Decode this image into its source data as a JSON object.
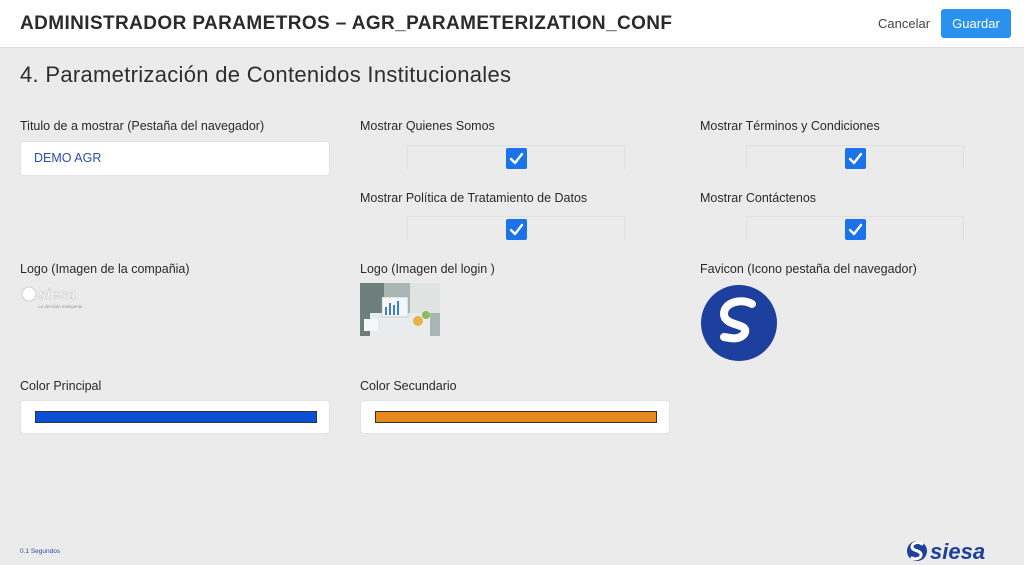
{
  "header": {
    "title": "ADMINISTRADOR PARAMETROS – AGR_PARAMETERIZATION_CONF",
    "cancel_label": "Cancelar",
    "save_label": "Guardar"
  },
  "section": {
    "title": "4. Parametrización de Contenidos Institucionales"
  },
  "fields": {
    "browser_title_label": "Titulo de a mostrar (Pestaña del navegador)",
    "browser_title_value": "DEMO AGR",
    "show_about_label": "Mostrar Quienes Somos",
    "show_about_checked": true,
    "show_terms_label": "Mostrar Términos y Condiciones",
    "show_terms_checked": true,
    "show_privacy_label": "Mostrar Política de Tratamiento de Datos",
    "show_privacy_checked": true,
    "show_contact_label": "Mostrar Contáctenos",
    "show_contact_checked": true,
    "company_logo_label": "Logo (Imagen de la compañia)",
    "login_logo_label": "Logo (Imagen del login )",
    "favicon_label": "Favicon (Icono pestaña del navegador)",
    "primary_color_label": "Color Principal",
    "primary_color": "#0a4fd4",
    "secondary_color_label": "Color Secundario",
    "secondary_color": "#e8891f"
  },
  "logos": {
    "company_logo_text": "siesa",
    "company_logo_tagline": "La decisión inteligente",
    "footer_logo_text": "siesa",
    "brand_color": "#1d3f9e"
  },
  "footer": {
    "time_text": "0.1 Segundos"
  },
  "colors": {
    "accent": "#2a91ef",
    "checkbox": "#1a73e8",
    "background": "#ebebeb"
  }
}
